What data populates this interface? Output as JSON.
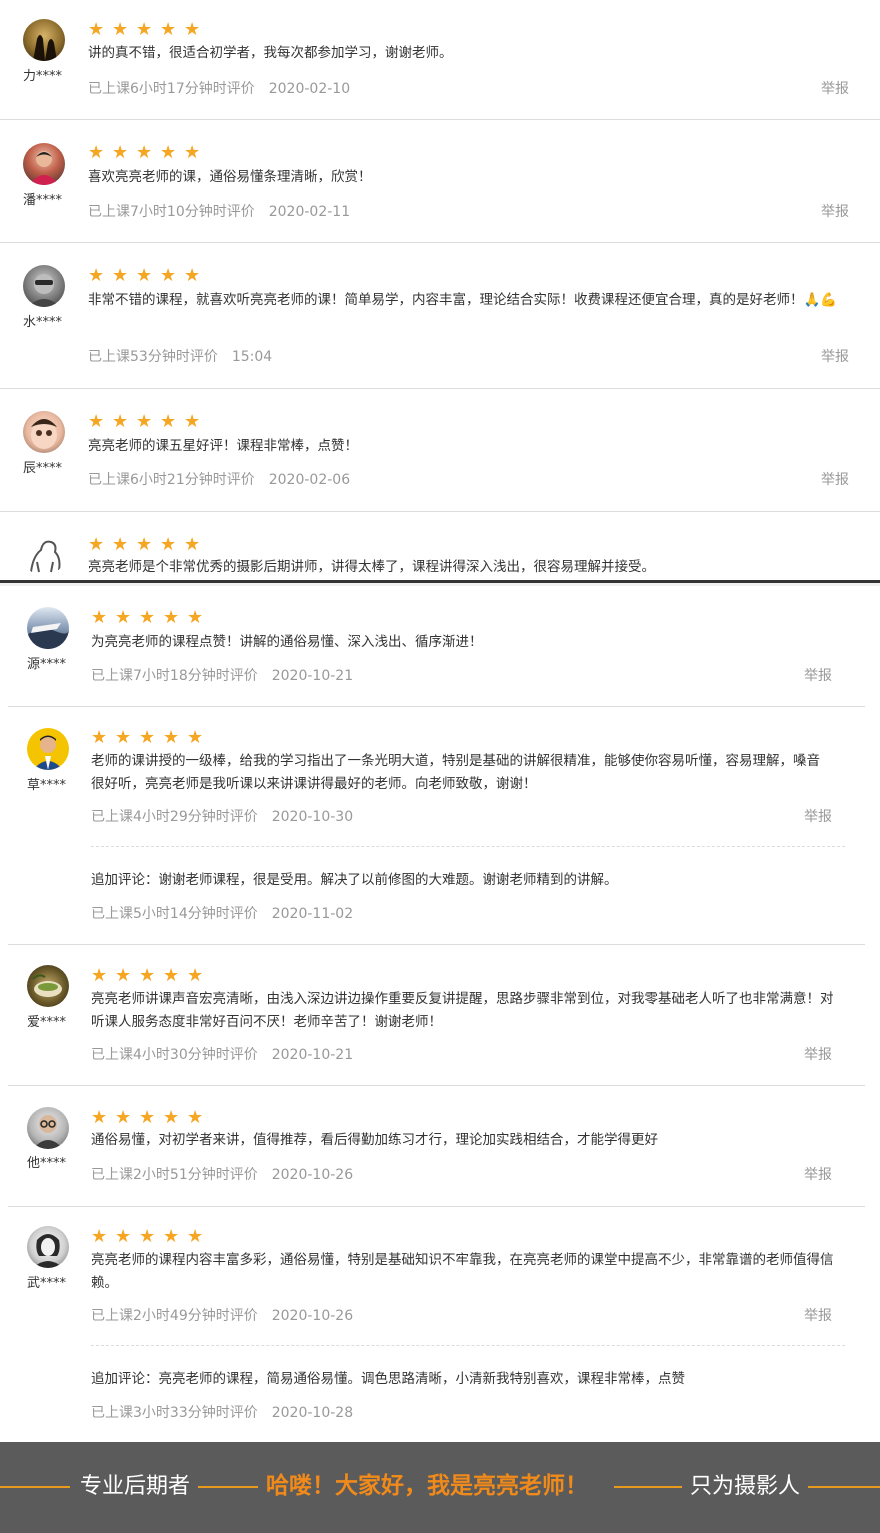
{
  "accent_color": "#f5a623",
  "star_glyph": "★",
  "report_label": "举报",
  "top_reviews": [
    {
      "user": "力****",
      "avatar": "dark-silhouette-avatar",
      "text": "讲的真不错，很适合初学者，我每次都参加学习，谢谢老师。",
      "learned": "已上课6小时17分钟时评价",
      "date": "2020-02-10",
      "stars": 5
    },
    {
      "user": "潘****",
      "avatar": "person-photo-avatar",
      "text": "喜欢亮亮老师的课，通俗易懂条理清晰，欣赏！",
      "learned": "已上课7小时10分钟时评价",
      "date": "2020-02-11",
      "stars": 5
    },
    {
      "user": "水****",
      "avatar": "gray-character-avatar",
      "text": "非常不错的课程，就喜欢听亮亮老师的课！简单易学，内容丰富，理论结合实际！收费课程还便宜合理，真的是好老师！🙏💪",
      "learned": "已上课53分钟时评价",
      "date": "15:04",
      "stars": 5
    },
    {
      "user": "辰****",
      "avatar": "doll-face-avatar",
      "text": "亮亮老师的课五星好评！课程非常棒，点赞！",
      "learned": "已上课6小时21分钟时评价",
      "date": "2020-02-06",
      "stars": 5
    },
    {
      "user": "",
      "avatar": "horse-sketch-avatar",
      "text": "亮亮老师是个非常优秀的摄影后期讲师，讲得太棒了，课程讲得深入浅出，很容易理解并接受。",
      "learned": "",
      "date": "",
      "stars": 5
    }
  ],
  "bottom_reviews": [
    {
      "user": "源****",
      "avatar": "landscape-avatar",
      "text": "为亮亮老师的课程点赞！讲解的通俗易懂、深入浅出、循序渐进！",
      "learned": "已上课7小时18分钟时评价",
      "date": "2020-10-21",
      "stars": 5
    },
    {
      "user": "草****",
      "avatar": "man-portrait-avatar",
      "text": "老师的课讲授的一级棒，给我的学习指出了一条光明大道，特别是基础的讲解很精准，能够使你容易听懂，容易理解，嗓音很好听，亮亮老师是我听课以来讲课讲得最好的老师。向老师致敬，谢谢！",
      "learned": "已上课4小时29分钟时评价",
      "date": "2020-10-30",
      "stars": 5,
      "followup": {
        "text": "追加评论：谢谢老师课程，很是受用。解决了以前修图的大难题。谢谢老师精到的讲解。",
        "learned": "已上课5小时14分钟时评价",
        "date": "2020-11-02"
      }
    },
    {
      "user": "爱****",
      "avatar": "tea-cup-avatar",
      "text": "亮亮老师讲课声音宏亮清晰，由浅入深边讲边操作重要反复讲提醒，思路步骤非常到位，对我零基础老人听了也非常满意！对听课人服务态度非常好百问不厌！老师辛苦了！谢谢老师！",
      "learned": "已上课4小时30分钟时评价",
      "date": "2020-10-21",
      "stars": 5
    },
    {
      "user": "他****",
      "avatar": "glasses-man-avatar",
      "text": "通俗易懂，对初学者来讲，值得推荐，看后得勤加练习才行，理论加实践相结合，才能学得更好",
      "learned": "已上课2小时51分钟时评价",
      "date": "2020-10-26",
      "stars": 5
    },
    {
      "user": "武****",
      "avatar": "sketch-portrait-avatar",
      "text": "亮亮老师的课程内容丰富多彩，通俗易懂，特别是基础知识不牢靠我，在亮亮老师的课堂中提高不少，非常靠谱的老师值得信赖。",
      "learned": "已上课2小时49分钟时评价",
      "date": "2020-10-26",
      "stars": 5,
      "followup": {
        "text": "追加评论：亮亮老师的课程，简易通俗易懂。调色思路清晰，小清新我特别喜欢，课程非常棒，点赞",
        "learned": "已上课3小时33分钟时评价",
        "date": "2020-10-28"
      }
    }
  ],
  "banner": {
    "left": "专业后期者",
    "center": "哈喽！大家好，我是亮亮老师！",
    "right": "只为摄影人",
    "background": "#5b5b5b",
    "highlight_color": "#f08a1a"
  }
}
